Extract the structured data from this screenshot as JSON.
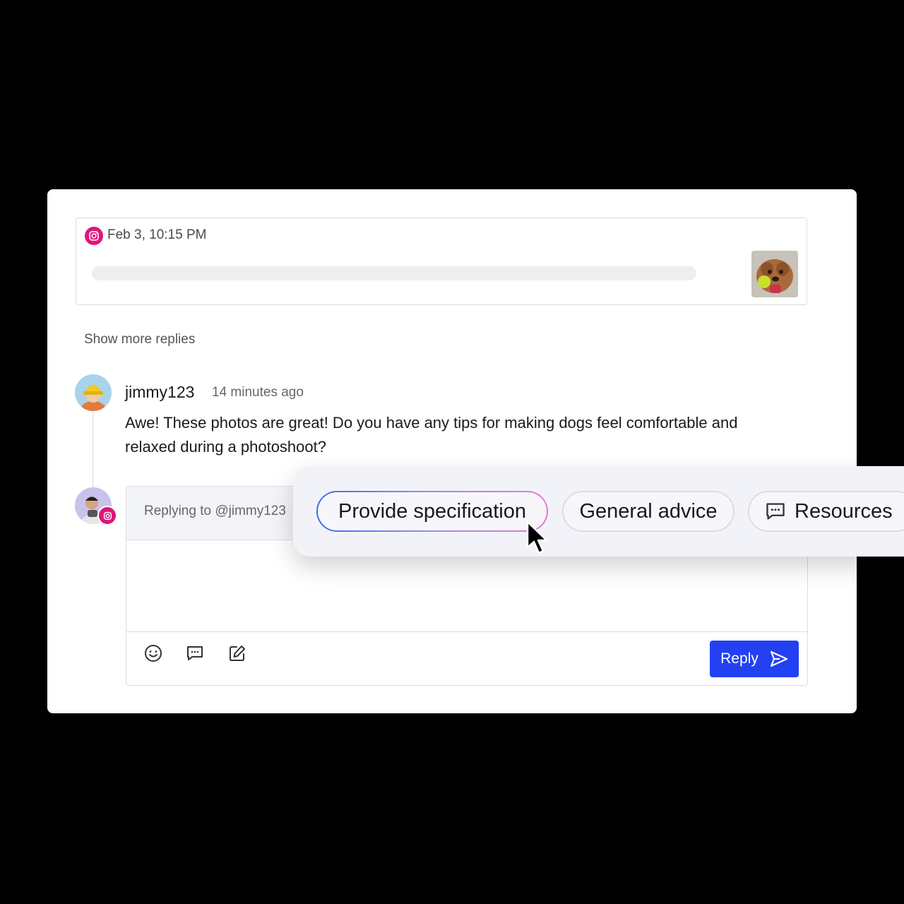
{
  "post": {
    "date": "Feb 3, 10:15 PM",
    "platform_icon": "instagram-icon"
  },
  "thread": {
    "show_more": "Show more replies"
  },
  "comment": {
    "username": "jimmy123",
    "time": "14 minutes ago",
    "text": "Awe! These photos are great! Do you have any tips for making dogs feel comfortable and relaxed during a photoshoot?"
  },
  "reply": {
    "replying_to": "Replying to @jimmy123",
    "button_label": "Reply",
    "tools": [
      "smiley-icon",
      "chat-icon",
      "edit-icon"
    ]
  },
  "suggestions": [
    {
      "label": "Provide specification",
      "active": true
    },
    {
      "label": "General advice",
      "active": false
    },
    {
      "label": "Resources",
      "active": false,
      "icon": "chat-icon"
    }
  ],
  "colors": {
    "instagram": "#e0157b",
    "primary": "#2341f2"
  }
}
